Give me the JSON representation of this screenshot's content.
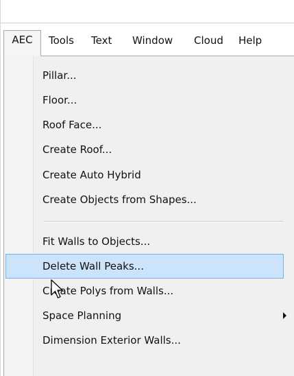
{
  "menubar": {
    "items": [
      {
        "label": "AEC"
      },
      {
        "label": "Tools"
      },
      {
        "label": "Text"
      },
      {
        "label": "Window"
      },
      {
        "label": "Cloud"
      },
      {
        "label": "Help"
      }
    ]
  },
  "dropdown": {
    "items": [
      {
        "label": "Pillar..."
      },
      {
        "label": "Floor..."
      },
      {
        "label": "Roof Face..."
      },
      {
        "label": "Create Roof..."
      },
      {
        "label": "Create Auto Hybrid"
      },
      {
        "label": "Create Objects from Shapes..."
      },
      {
        "label": "Fit Walls to Objects..."
      },
      {
        "label": "Delete Wall Peaks..."
      },
      {
        "label": "Create Polys from Walls..."
      },
      {
        "label": "Space Planning"
      },
      {
        "label": "Dimension Exterior Walls..."
      }
    ],
    "highlighted": "Delete Wall Peaks...",
    "submenu_icon": "chevron-right-icon"
  },
  "cursor": {
    "icon": "mouse-pointer-icon"
  }
}
